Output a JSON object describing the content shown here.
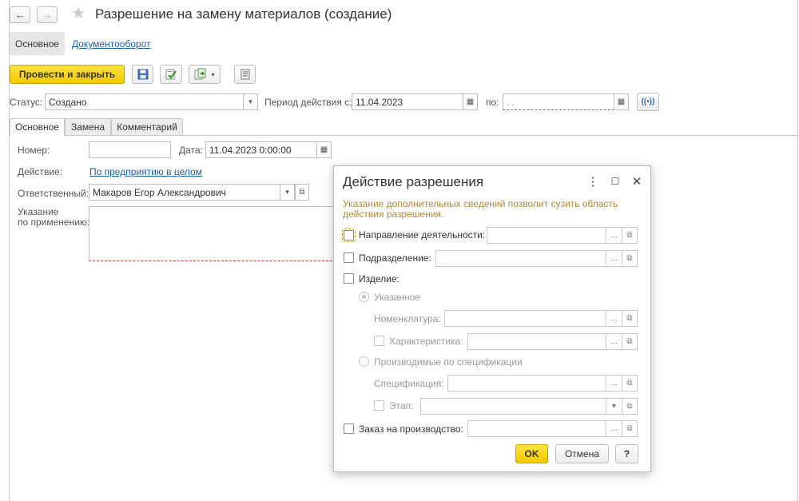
{
  "window": {
    "title": "Разрешение на замену материалов (создание)",
    "back_icon": "←",
    "forward_icon": "→",
    "star_icon": "★"
  },
  "top_tabs": {
    "main": "Основное",
    "docflow": "Документооборот"
  },
  "toolbar": {
    "post_close": "Провести и закрыть",
    "save_icon": "save-icon",
    "post_icon": "post-icon",
    "create_based_icon": "create-based-icon",
    "report_icon": "report-icon"
  },
  "status": {
    "label": "Статус:",
    "value": "Создано",
    "period_label": "Период действия с:",
    "period_from": "11.04.2023",
    "to_label": "по:",
    "period_to": " .  ."
  },
  "page_tabs": [
    "Основное",
    "Замена",
    "Комментарий"
  ],
  "form": {
    "number_label": "Номер:",
    "number_value": "",
    "date_label": "Дата:",
    "date_value": "11.04.2023  0:00:00",
    "action_label": "Действие:",
    "action_value": "По предприятию в целом",
    "responsible_label": "Ответственный:",
    "responsible_value": "Макаров Егор Александрович",
    "usage_label_1": "Указание",
    "usage_label_2": "по применению:"
  },
  "dialog": {
    "title": "Действие разрешения",
    "hint": "Указание дополнительных сведений позволит сузить область действия разрешения.",
    "activity_label": "Направление деятельности:",
    "department_label": "Подразделение:",
    "product_label": "Изделие:",
    "specified_label": "Указанное",
    "nomenclature_label": "Номенклатура:",
    "characteristic_label": "Характеристика:",
    "produced_label": "Производимые по спецификации",
    "specification_label": "Спецификация:",
    "stage_label": "Этап:",
    "order_label": "Заказ на производство:",
    "ok": "OK",
    "cancel": "Отмена",
    "help": "?"
  },
  "colors": {
    "accent_yellow": "#f8d61c",
    "link_blue": "#1d5fb3",
    "hint_brown": "#b08a3c",
    "required_red": "#e04040"
  }
}
